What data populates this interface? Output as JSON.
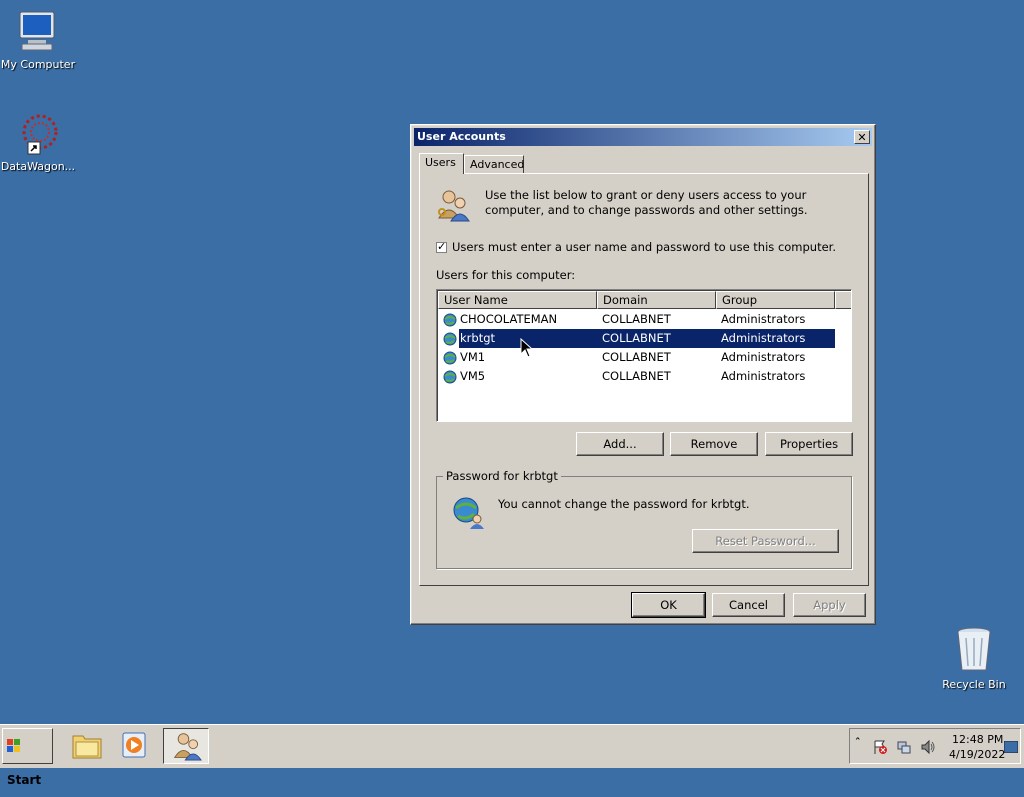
{
  "desktop": {
    "icons": [
      {
        "label": "My Computer",
        "icon": "computer-icon"
      },
      {
        "label": "DataWagon...",
        "icon": "datawagon-shortcut-icon"
      },
      {
        "label": "Recycle Bin",
        "icon": "recycle-bin-icon"
      }
    ]
  },
  "dialog": {
    "title": "User Accounts",
    "close_label": "✕",
    "tabs": [
      {
        "label": "Users",
        "active": true
      },
      {
        "label": "Advanced",
        "active": false
      }
    ],
    "intro_text": "Use the list below to grant or deny users access to your computer, and to change passwords and other settings.",
    "checkbox_label": "Users must enter a user name and password to use this computer.",
    "checkbox_checked": true,
    "users_label": "Users for this computer:",
    "columns": [
      "User Name",
      "Domain",
      "Group"
    ],
    "users": [
      {
        "name": "CHOCOLATEMAN",
        "domain": "COLLABNET",
        "group": "Administrators",
        "selected": false
      },
      {
        "name": "krbtgt",
        "domain": "COLLABNET",
        "group": "Administrators",
        "selected": true
      },
      {
        "name": "VM1",
        "domain": "COLLABNET",
        "group": "Administrators",
        "selected": false
      },
      {
        "name": "VM5",
        "domain": "COLLABNET",
        "group": "Administrators",
        "selected": false
      }
    ],
    "buttons": {
      "add": "Add...",
      "remove": "Remove",
      "properties": "Properties"
    },
    "password_group": {
      "title": "Password for krbtgt",
      "message": "You cannot change the password for krbtgt.",
      "reset_label": "Reset Password..."
    },
    "footer": {
      "ok": "OK",
      "cancel": "Cancel",
      "apply": "Apply"
    }
  },
  "taskbar": {
    "start_label": "Start",
    "apps": [
      "file-explorer-icon",
      "media-player-icon",
      "user-accounts-icon"
    ],
    "clock": {
      "time": "12:48 PM",
      "date": "4/19/2022"
    }
  }
}
